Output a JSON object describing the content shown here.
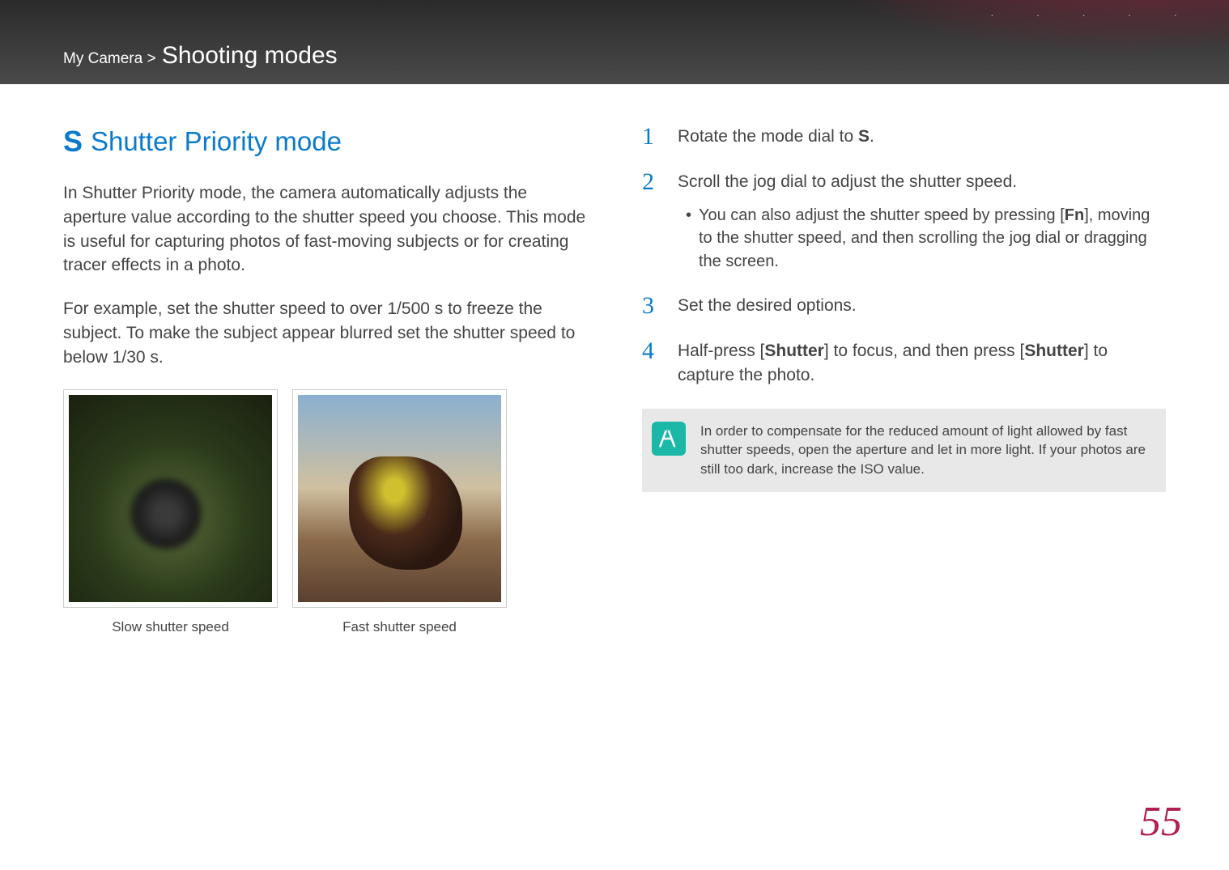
{
  "header": {
    "breadcrumb_parent": "My Camera",
    "breadcrumb_sep": " > ",
    "breadcrumb_title": "Shooting modes"
  },
  "left": {
    "s_icon_label": "S",
    "section_title": "Shutter Priority mode",
    "para1": "In Shutter Priority mode, the camera automatically adjusts the aperture value according to the shutter speed you choose. This mode is useful for capturing photos of fast-moving subjects or for creating tracer effects in a photo.",
    "para2": "For example, set the shutter speed to over 1/500 s to freeze the subject. To make the subject appear blurred set the shutter speed to below 1/30 s.",
    "caption1": "Slow shutter speed",
    "caption2": "Fast shutter speed"
  },
  "steps": [
    {
      "num": "1",
      "text_before": "Rotate the mode dial to ",
      "icon": "S",
      "text_after": "."
    },
    {
      "num": "2",
      "text": "Scroll the jog dial to adjust the shutter speed.",
      "sub_before": "You can also adjust the shutter speed by pressing [",
      "sub_icon": "Fn",
      "sub_after": "], moving to the shutter speed, and then scrolling the jog dial or dragging the screen."
    },
    {
      "num": "3",
      "text": "Set the desired options."
    },
    {
      "num": "4",
      "text_before": "Half-press [",
      "bold1": "Shutter",
      "text_mid": "] to focus, and then press [",
      "bold2": "Shutter",
      "text_after": "] to capture the photo."
    }
  ],
  "note": {
    "text": "In order to compensate for the reduced amount of light allowed by fast shutter speeds, open the aperture and let in more light. If your photos are still too dark, increase the ISO value."
  },
  "page_number": "55"
}
